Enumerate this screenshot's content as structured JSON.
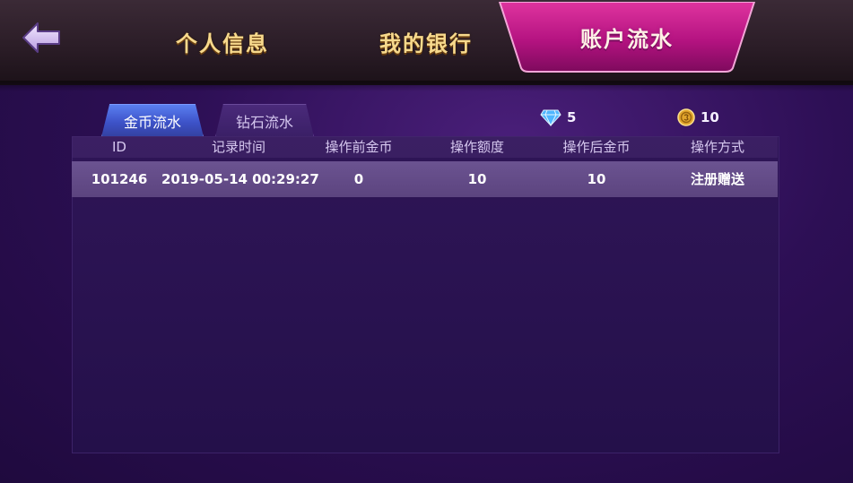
{
  "header": {
    "tabs": [
      {
        "label": "个人信息"
      },
      {
        "label": "我的银行"
      },
      {
        "label": "账户流水"
      }
    ]
  },
  "sub_tabs": [
    {
      "label": "金币流水"
    },
    {
      "label": "钻石流水"
    }
  ],
  "balances": {
    "diamond": "5",
    "coin": "10"
  },
  "table": {
    "columns": [
      "ID",
      "记录时间",
      "操作前金币",
      "操作额度",
      "操作后金币",
      "操作方式"
    ],
    "rows": [
      {
        "id": "101246",
        "time": "2019-05-14 00:29:27",
        "before": "0",
        "amount": "10",
        "after": "10",
        "method": "注册赠送"
      }
    ]
  },
  "colors": {
    "active_tab": "#c2188f",
    "gold_text": "#f7d98c",
    "panel_bg": "#2a1250",
    "row_highlight": "#654c8a"
  }
}
